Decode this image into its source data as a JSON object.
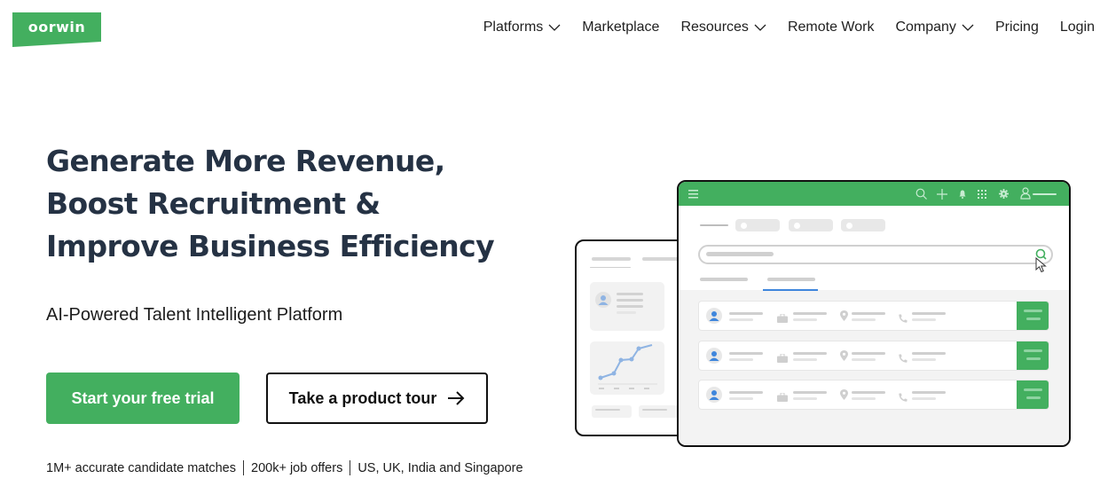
{
  "brand": {
    "name": "oorwin",
    "color": "#43af5f"
  },
  "nav": {
    "items": [
      {
        "label": "Platforms",
        "dropdown": true
      },
      {
        "label": "Marketplace",
        "dropdown": false
      },
      {
        "label": "Resources",
        "dropdown": true
      },
      {
        "label": "Remote Work",
        "dropdown": false
      },
      {
        "label": "Company",
        "dropdown": true
      },
      {
        "label": "Pricing",
        "dropdown": false
      },
      {
        "label": "Login",
        "dropdown": false
      }
    ]
  },
  "hero": {
    "headline": [
      "Generate More Revenue,",
      "Boost Recruitment &",
      "Improve Business Efficiency"
    ],
    "subtitle": "AI-Powered Talent Intelligent Platform",
    "primary_cta": "Start your free trial",
    "secondary_cta": "Take a product tour",
    "secondary_cta_icon": "arrow-right-icon",
    "stats": [
      "1M+ accurate candidate matches",
      "200k+ job offers",
      "US, UK, India and Singapore"
    ]
  },
  "illustration": {
    "toolbar_icons": [
      "menu-icon",
      "search-icon",
      "plus-icon",
      "bell-icon",
      "apps-grid-icon",
      "gear-icon",
      "user-icon"
    ],
    "filter_chips": 3,
    "result_rows": 3,
    "row_icons": [
      "user-avatar-icon",
      "briefcase-icon",
      "location-pin-icon",
      "phone-icon"
    ],
    "colors": {
      "accent": "#43af5f",
      "avatar": "#3f86dc",
      "chart_line": "#8fb4e3",
      "tab_underline": "#3f86dc"
    }
  }
}
